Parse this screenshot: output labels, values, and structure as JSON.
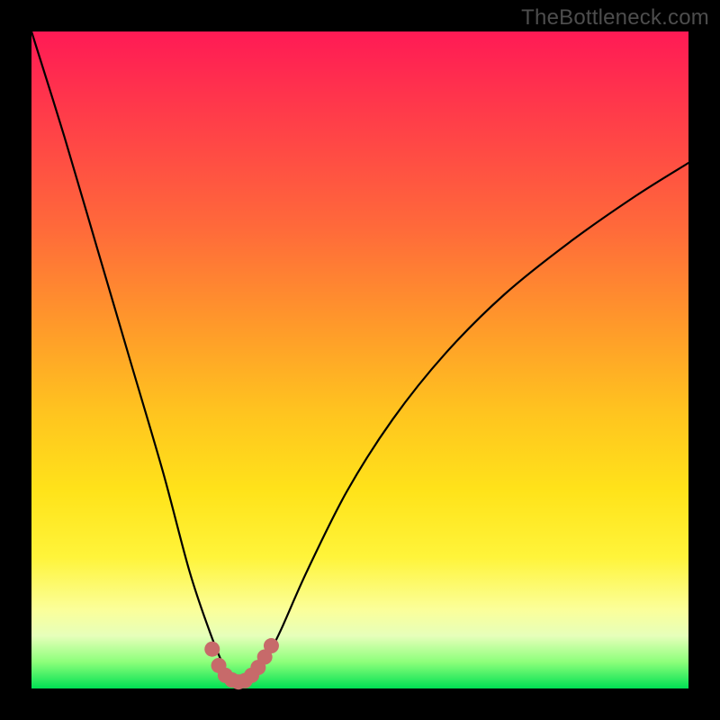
{
  "watermark": "TheBottleneck.com",
  "colors": {
    "frame_bg": "#000000",
    "curve_stroke": "#000000",
    "marker_stroke": "#c76a6a",
    "gradient_top": "#ff1a55",
    "gradient_bottom": "#00e053"
  },
  "chart_data": {
    "type": "line",
    "title": "",
    "xlabel": "",
    "ylabel": "",
    "xlim": [
      0,
      100
    ],
    "ylim": [
      0,
      100
    ],
    "grid": false,
    "legend": false,
    "annotations": [],
    "series": [
      {
        "name": "bottleneck-curve",
        "x": [
          0,
          5,
          10,
          15,
          20,
          24,
          27,
          29,
          30.5,
          32,
          33,
          34.5,
          36,
          38,
          42,
          48,
          55,
          63,
          72,
          82,
          92,
          100
        ],
        "y": [
          100,
          84,
          67,
          50,
          33,
          18,
          9,
          4,
          1.5,
          0.8,
          1.0,
          2.5,
          5,
          9,
          18,
          30,
          41,
          51,
          60,
          68,
          75,
          80
        ]
      }
    ],
    "markers": {
      "name": "valley-markers",
      "x": [
        27.5,
        28.5,
        29.5,
        30.5,
        31.5,
        32.5,
        33.5,
        34.5,
        35.5,
        36.5
      ],
      "y": [
        6.0,
        3.5,
        2.0,
        1.3,
        1.0,
        1.2,
        2.0,
        3.2,
        4.8,
        6.5
      ]
    }
  }
}
